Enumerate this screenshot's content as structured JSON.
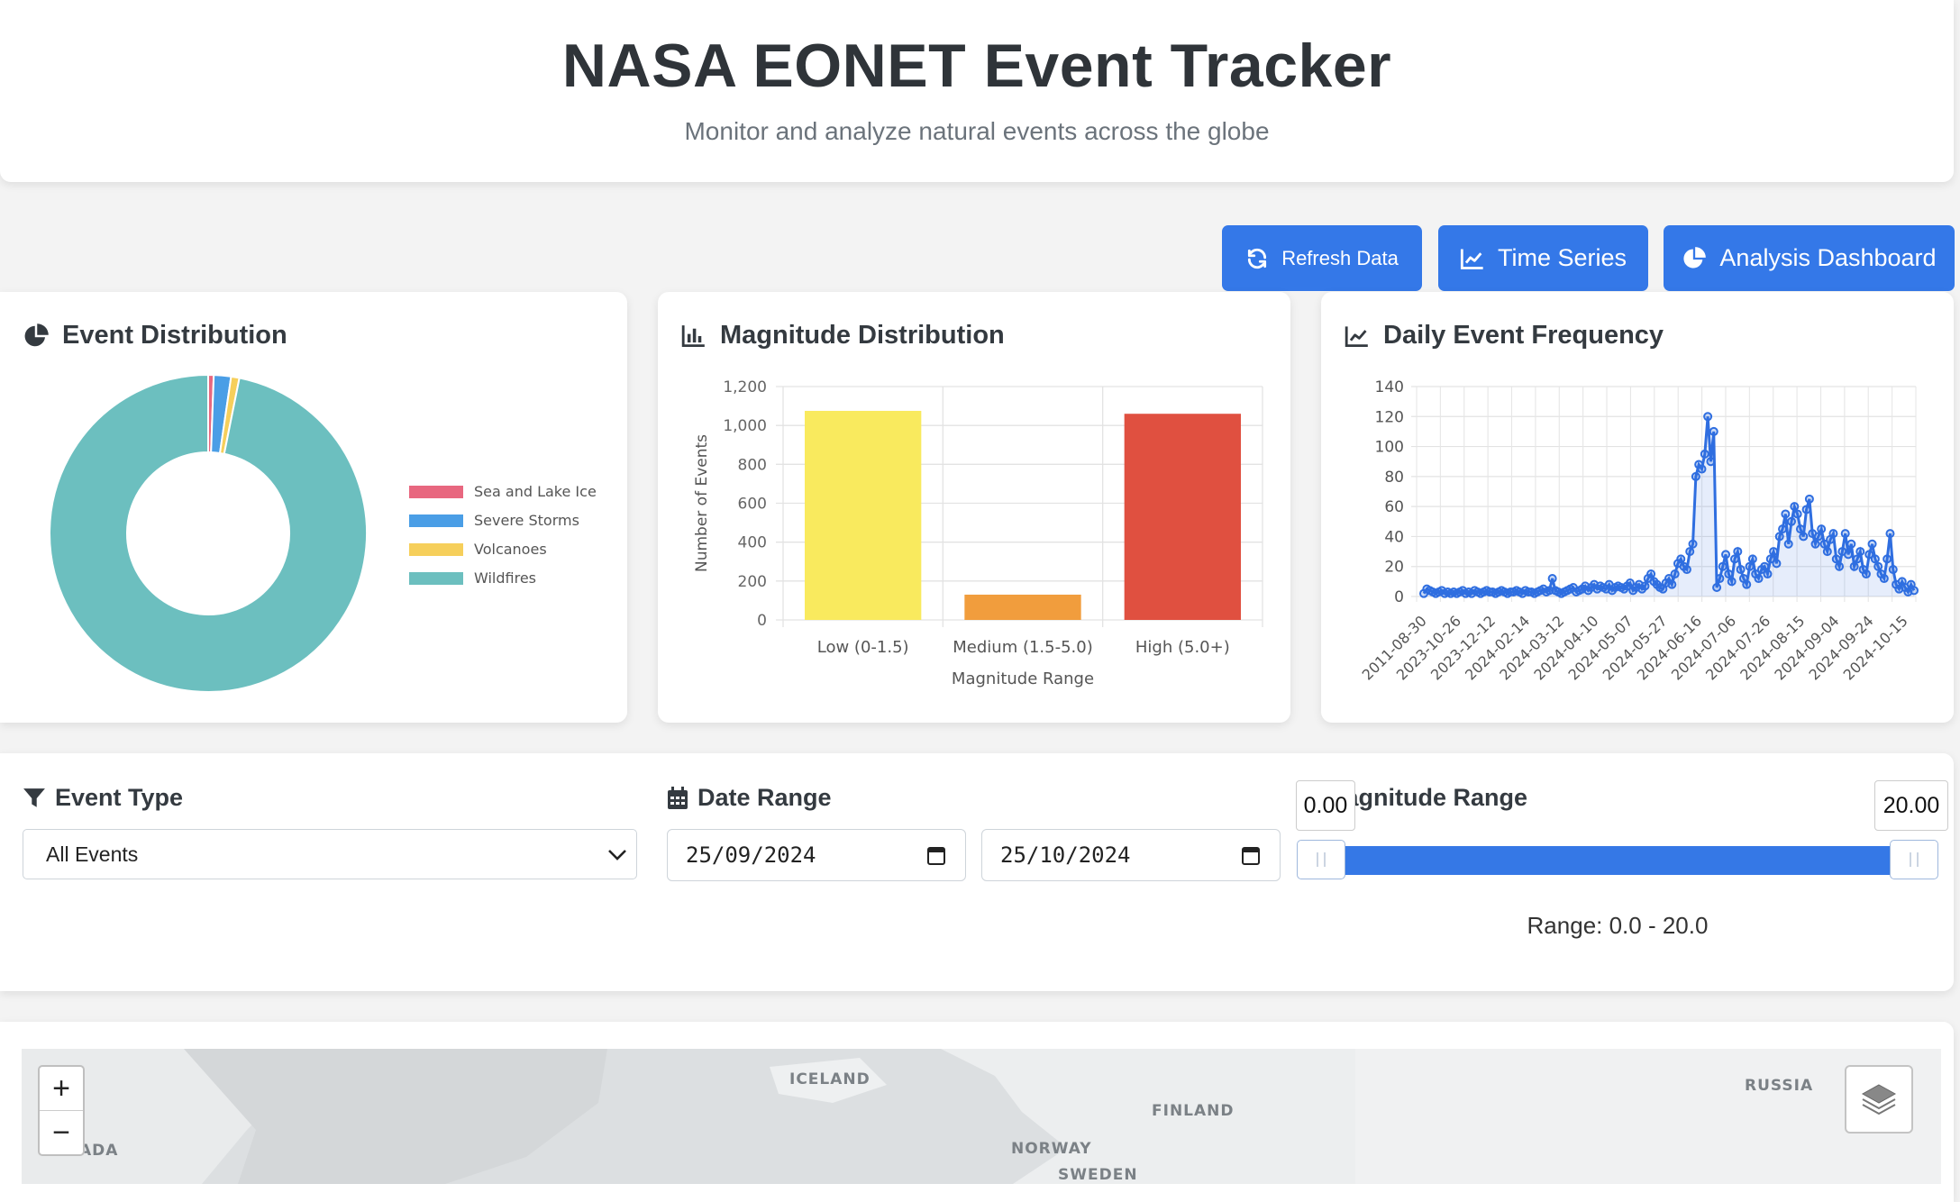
{
  "header": {
    "title": "NASA EONET Event Tracker",
    "subtitle": "Monitor and analyze natural events across the globe"
  },
  "toolbar": {
    "refresh_label": "Refresh Data",
    "timeseries_label": "Time Series",
    "analysis_label": "Analysis Dashboard",
    "accent_color": "#3478e8"
  },
  "panels": {
    "event_distribution_title": "Event Distribution",
    "magnitude_distribution_title": "Magnitude Distribution",
    "daily_frequency_title": "Daily Event Frequency"
  },
  "chart_data": [
    {
      "type": "pie",
      "variant": "doughnut",
      "labels": [
        "Sea and Lake Ice",
        "Severe Storms",
        "Volcanoes",
        "Wildfires"
      ],
      "values": [
        8,
        25,
        12,
        1380
      ],
      "colors": [
        "#e8677f",
        "#4a9ee6",
        "#f6cf5b",
        "#6cbfbf"
      ],
      "legend_position": "right"
    },
    {
      "type": "bar",
      "categories": [
        "Low (0-1.5)",
        "Medium (1.5-5.0)",
        "High (5.0+)"
      ],
      "values": [
        1075,
        130,
        1060
      ],
      "colors": [
        "#f9ea5e",
        "#f19d3d",
        "#e05040"
      ],
      "xlabel": "Magnitude Range",
      "ylabel": "Number of Events",
      "ylim": [
        0,
        1200
      ],
      "yticks": [
        "0",
        "200",
        "400",
        "600",
        "800",
        "1,000",
        "1,200"
      ],
      "grid": true
    },
    {
      "type": "line",
      "area": true,
      "ylim": [
        0,
        140
      ],
      "yticks": [
        0,
        20,
        40,
        60,
        80,
        100,
        120,
        140
      ],
      "xticks": [
        "2011-08-30",
        "2023-10-26",
        "2023-12-12",
        "2024-02-14",
        "2024-03-12",
        "2024-04-10",
        "2024-05-07",
        "2024-05-27",
        "2024-06-16",
        "2024-07-06",
        "2024-07-26",
        "2024-08-15",
        "2024-09-04",
        "2024-09-24",
        "2024-10-15"
      ],
      "values": [
        2,
        5,
        4,
        3,
        2,
        3,
        4,
        2,
        3,
        2,
        3,
        2,
        3,
        4,
        2,
        3,
        2,
        4,
        3,
        2,
        3,
        4,
        3,
        3,
        2,
        3,
        4,
        3,
        2,
        3,
        3,
        4,
        3,
        2,
        4,
        3,
        3,
        2,
        3,
        4,
        5,
        3,
        4,
        12,
        4,
        3,
        2,
        3,
        4,
        5,
        6,
        3,
        4,
        5,
        7,
        4,
        6,
        8,
        5,
        7,
        6,
        5,
        8,
        4,
        6,
        7,
        6,
        5,
        7,
        9,
        4,
        6,
        8,
        5,
        7,
        12,
        15,
        10,
        8,
        6,
        5,
        9,
        12,
        8,
        15,
        22,
        25,
        20,
        18,
        30,
        35,
        80,
        88,
        85,
        95,
        120,
        90,
        110,
        6,
        12,
        20,
        28,
        15,
        10,
        25,
        30,
        18,
        12,
        8,
        20,
        25,
        15,
        12,
        18,
        20,
        15,
        25,
        30,
        22,
        40,
        45,
        55,
        35,
        50,
        60,
        55,
        45,
        40,
        58,
        65,
        42,
        35,
        40,
        45,
        35,
        30,
        38,
        42,
        25,
        20,
        30,
        42,
        28,
        35,
        20,
        25,
        30,
        18,
        15,
        28,
        35,
        25,
        20,
        15,
        12,
        25,
        42,
        18,
        8,
        5,
        10,
        6,
        3,
        8,
        4
      ],
      "line_color": "#2f6ee0",
      "grid": true
    }
  ],
  "filters": {
    "event_type_label": "Event Type",
    "event_type_value": "All Events",
    "date_range_label": "Date Range",
    "date_start": "25/09/2024",
    "date_end": "25/10/2024",
    "magnitude_label": "Magnitude Range",
    "mag_min_value": "0.00",
    "mag_max_value": "20.00",
    "range_text": "Range: 0.0 - 20.0",
    "slider_min_fraction": 0,
    "slider_max_fraction": 1
  },
  "map": {
    "labels": [
      "ICELAND",
      "FINLAND",
      "NORWAY",
      "SWEDEN",
      "RUSSIA",
      "ADA"
    ],
    "zoom_in": "+",
    "zoom_out": "−"
  }
}
